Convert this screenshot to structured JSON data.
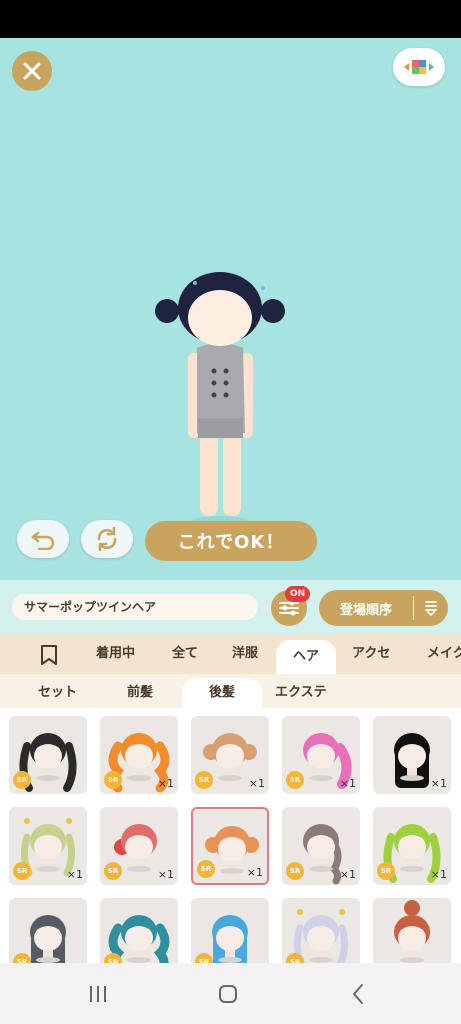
{
  "colors": {
    "gold": "#c8a45e",
    "stage": "#a6e3e1",
    "badge_red": "#e63b3b",
    "sr_orange": "#f2b53a",
    "select_pink": "#e07a86"
  },
  "stage": {
    "ok_label": "これでOK！",
    "icons": [
      "close-icon",
      "layout-icon",
      "undo-icon",
      "refresh-icon"
    ]
  },
  "search": {
    "item_name": "サマーポップツインヘア",
    "filter_badge": "ON",
    "sort_label": "登場順序"
  },
  "categories": [
    {
      "label": "着用中"
    },
    {
      "label": "全て"
    },
    {
      "label": "洋服"
    },
    {
      "label": "ヘア",
      "active": true
    },
    {
      "label": "アクセ"
    },
    {
      "label": "メイク"
    }
  ],
  "subcategories": [
    {
      "label": "セット"
    },
    {
      "label": "前髪"
    },
    {
      "label": "後髪",
      "active": true
    },
    {
      "label": "エクステ"
    }
  ],
  "items": [
    {
      "rarity": "SR",
      "count": "",
      "hair": "#2a2a2a",
      "style": "twin-long"
    },
    {
      "rarity": "SR",
      "count": "×1",
      "hair": "#f08c2c",
      "style": "twin-wavy"
    },
    {
      "rarity": "SR",
      "count": "×1",
      "hair": "#d8a070",
      "style": "buns"
    },
    {
      "rarity": "SR",
      "count": "×1",
      "hair": "#e86fb8",
      "style": "side-tail"
    },
    {
      "rarity": "",
      "count": "×1",
      "hair": "#111111",
      "style": "long"
    },
    {
      "rarity": "SR",
      "count": "×1",
      "hair": "#c8d090",
      "style": "twin-deco"
    },
    {
      "rarity": "SR",
      "count": "×1",
      "hair": "#e06c6c",
      "style": "side-bun"
    },
    {
      "rarity": "SR",
      "count": "×1",
      "hair": "#e89258",
      "style": "twin-buns",
      "selected": true
    },
    {
      "rarity": "SR",
      "count": "×1",
      "hair": "#8a7a78",
      "style": "braid"
    },
    {
      "rarity": "SR",
      "count": "×1",
      "hair": "#9ed040",
      "style": "twin-long"
    },
    {
      "rarity": "SR",
      "count": "",
      "hair": "#555a66",
      "style": "long"
    },
    {
      "rarity": "SR",
      "count": "",
      "hair": "#2f8f9c",
      "style": "twin-wavy"
    },
    {
      "rarity": "SR",
      "count": "",
      "hair": "#48a8e0",
      "style": "long"
    },
    {
      "rarity": "SR",
      "count": "",
      "hair": "#d0d0e8",
      "style": "twin-deco"
    },
    {
      "rarity": "",
      "count": "",
      "hair": "#c86040",
      "style": "top-bun"
    }
  ]
}
